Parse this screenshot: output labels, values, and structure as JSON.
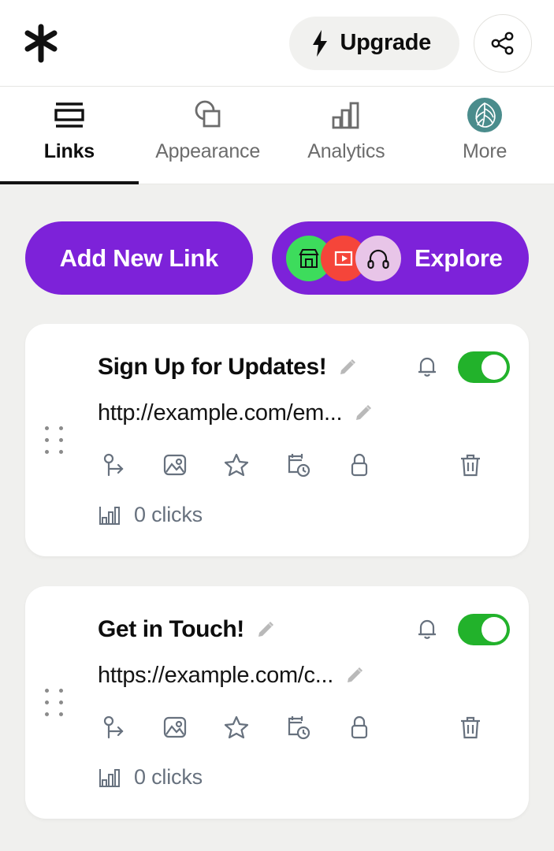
{
  "header": {
    "logo_icon": "asterisk-logo",
    "upgrade_label": "Upgrade",
    "upgrade_icon": "lightning-bolt-icon",
    "share_icon": "share-icon"
  },
  "tabs": [
    {
      "label": "Links",
      "icon": "links-icon",
      "active": true
    },
    {
      "label": "Appearance",
      "icon": "appearance-icon",
      "active": false
    },
    {
      "label": "Analytics",
      "icon": "analytics-icon",
      "active": false
    },
    {
      "label": "More",
      "icon": "more-leaf-icon",
      "active": false
    }
  ],
  "actions": {
    "add_new_link_label": "Add New Link",
    "explore_label": "Explore",
    "explore_avatars": [
      {
        "icon": "store-icon",
        "color": "#3ddc5c"
      },
      {
        "icon": "video-play-icon",
        "color": "#f5453a"
      },
      {
        "icon": "headphones-icon",
        "color": "#e8c5e8"
      }
    ]
  },
  "links": [
    {
      "title": "Sign Up for Updates!",
      "url": "http://example.com/em...",
      "enabled": true,
      "clicks_label": "0 clicks"
    },
    {
      "title": "Get in Touch!",
      "url": "https://example.com/c...",
      "enabled": true,
      "clicks_label": "0 clicks"
    }
  ],
  "card_icons": [
    "redirect-icon",
    "image-icon",
    "star-icon",
    "schedule-icon",
    "lock-icon"
  ],
  "delete_icon": "trash-icon",
  "colors": {
    "brand_purple": "#7d22d9",
    "toggle_green": "#22b22b",
    "page_background": "#f0f0ee",
    "more_tab_teal": "#4a8c8c"
  }
}
